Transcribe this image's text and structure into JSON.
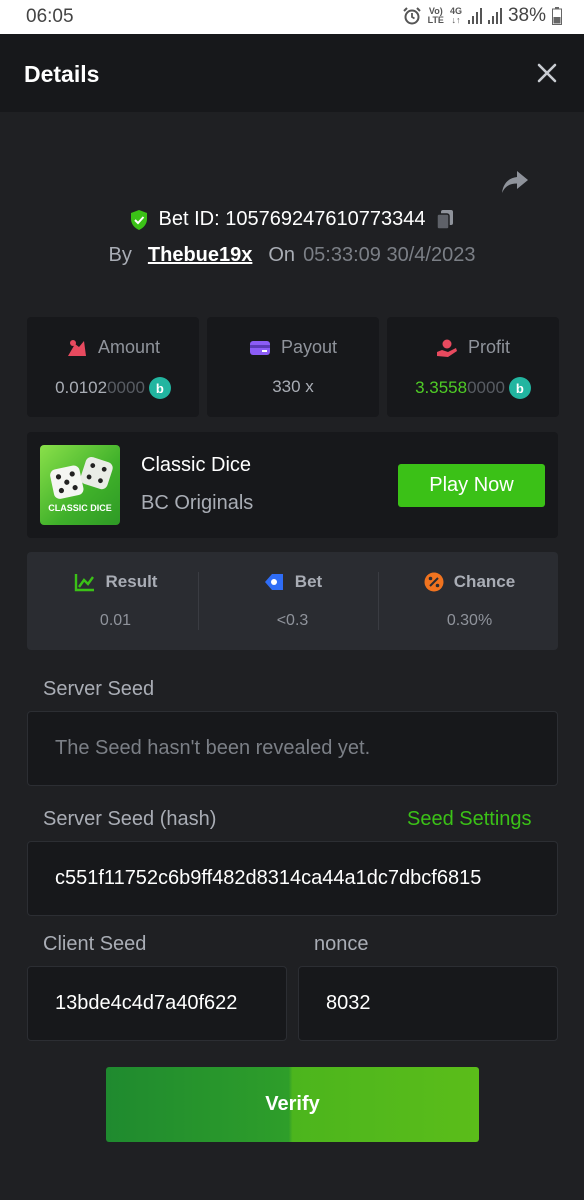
{
  "status_bar": {
    "time": "06:05",
    "network_top": "Vo)",
    "network_bottom": "LTE",
    "net_gen_top": "4G",
    "net_gen_bottom": "↓↑",
    "battery": "38%"
  },
  "header": {
    "title": "Details"
  },
  "bet": {
    "id_label": "Bet ID: 105769247610773344",
    "by_label": "By",
    "username": "Thebue19x",
    "on_label": "On",
    "datetime": "05:33:09 30/4/2023"
  },
  "stats": {
    "amount": {
      "label": "Amount",
      "value_main": "0.0102",
      "value_zeros": "0000"
    },
    "payout": {
      "label": "Payout",
      "value": "330 x"
    },
    "profit": {
      "label": "Profit",
      "value_main": "3.3558",
      "value_zeros": "0000"
    },
    "coin_symbol": "b"
  },
  "game": {
    "thumb_label": "CLASSIC DICE",
    "name": "Classic Dice",
    "provider": "BC Originals",
    "play_label": "Play Now"
  },
  "result": {
    "result_label": "Result",
    "result_value": "0.01",
    "bet_label": "Bet",
    "bet_value": "<0.3",
    "chance_label": "Chance",
    "chance_value": "0.30%"
  },
  "seeds": {
    "server_seed_label": "Server Seed",
    "server_seed_placeholder": "The Seed hasn't been revealed yet.",
    "server_hash_label": "Server Seed (hash)",
    "seed_settings_label": "Seed Settings",
    "server_hash_value": "c551f11752c6b9ff482d8314ca44a1dc7dbcf6815",
    "client_seed_label": "Client Seed",
    "client_seed_value": "13bde4c4d7a40f622",
    "nonce_label": "nonce",
    "nonce_value": "8032"
  },
  "verify_label": "Verify",
  "colors": {
    "accent_green": "#3bc117",
    "background": "#1f2023",
    "panel": "#17181b",
    "coin": "#22b5a0"
  }
}
